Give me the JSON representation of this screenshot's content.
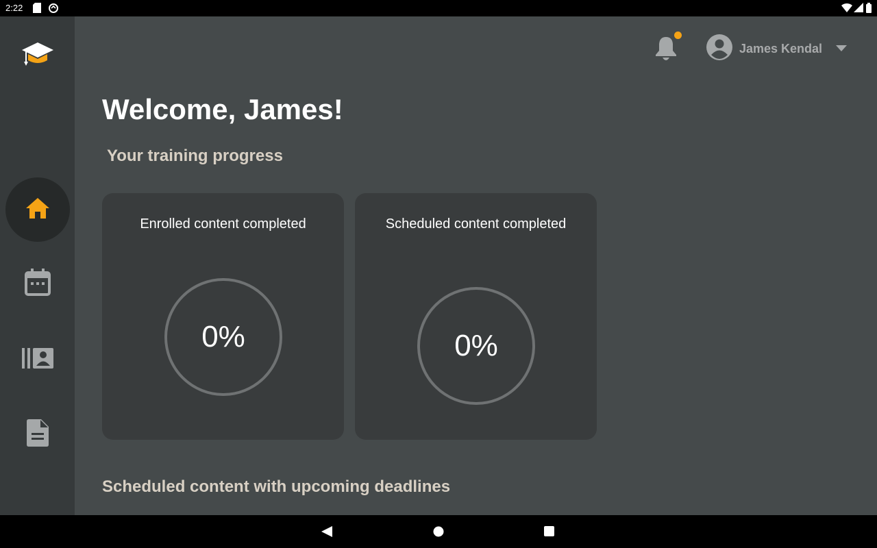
{
  "status_bar": {
    "time": "2:22",
    "icons": [
      "sd-card-icon",
      "sync-icon",
      "wifi-icon",
      "signal-icon",
      "battery-icon"
    ]
  },
  "sidebar": {
    "logo": "graduation-cap-icon",
    "items": [
      {
        "name": "home",
        "icon": "home-icon",
        "active": true
      },
      {
        "name": "calendar",
        "icon": "calendar-icon",
        "active": false
      },
      {
        "name": "library",
        "icon": "library-icon",
        "active": false
      },
      {
        "name": "documents",
        "icon": "document-icon",
        "active": false
      }
    ]
  },
  "header": {
    "user_name": "James Kendal",
    "has_notification": true
  },
  "main": {
    "welcome": "Welcome, James!",
    "progress_title": "Your training progress",
    "cards": [
      {
        "title": "Enrolled content completed",
        "value": "0%"
      },
      {
        "title": "Scheduled content completed",
        "value": "0%"
      }
    ],
    "deadlines_title": "Scheduled content with upcoming deadlines"
  },
  "colors": {
    "accent": "#f5a316",
    "background": "#454a4b",
    "sidebar": "#363a3b",
    "card": "#393c3d"
  }
}
